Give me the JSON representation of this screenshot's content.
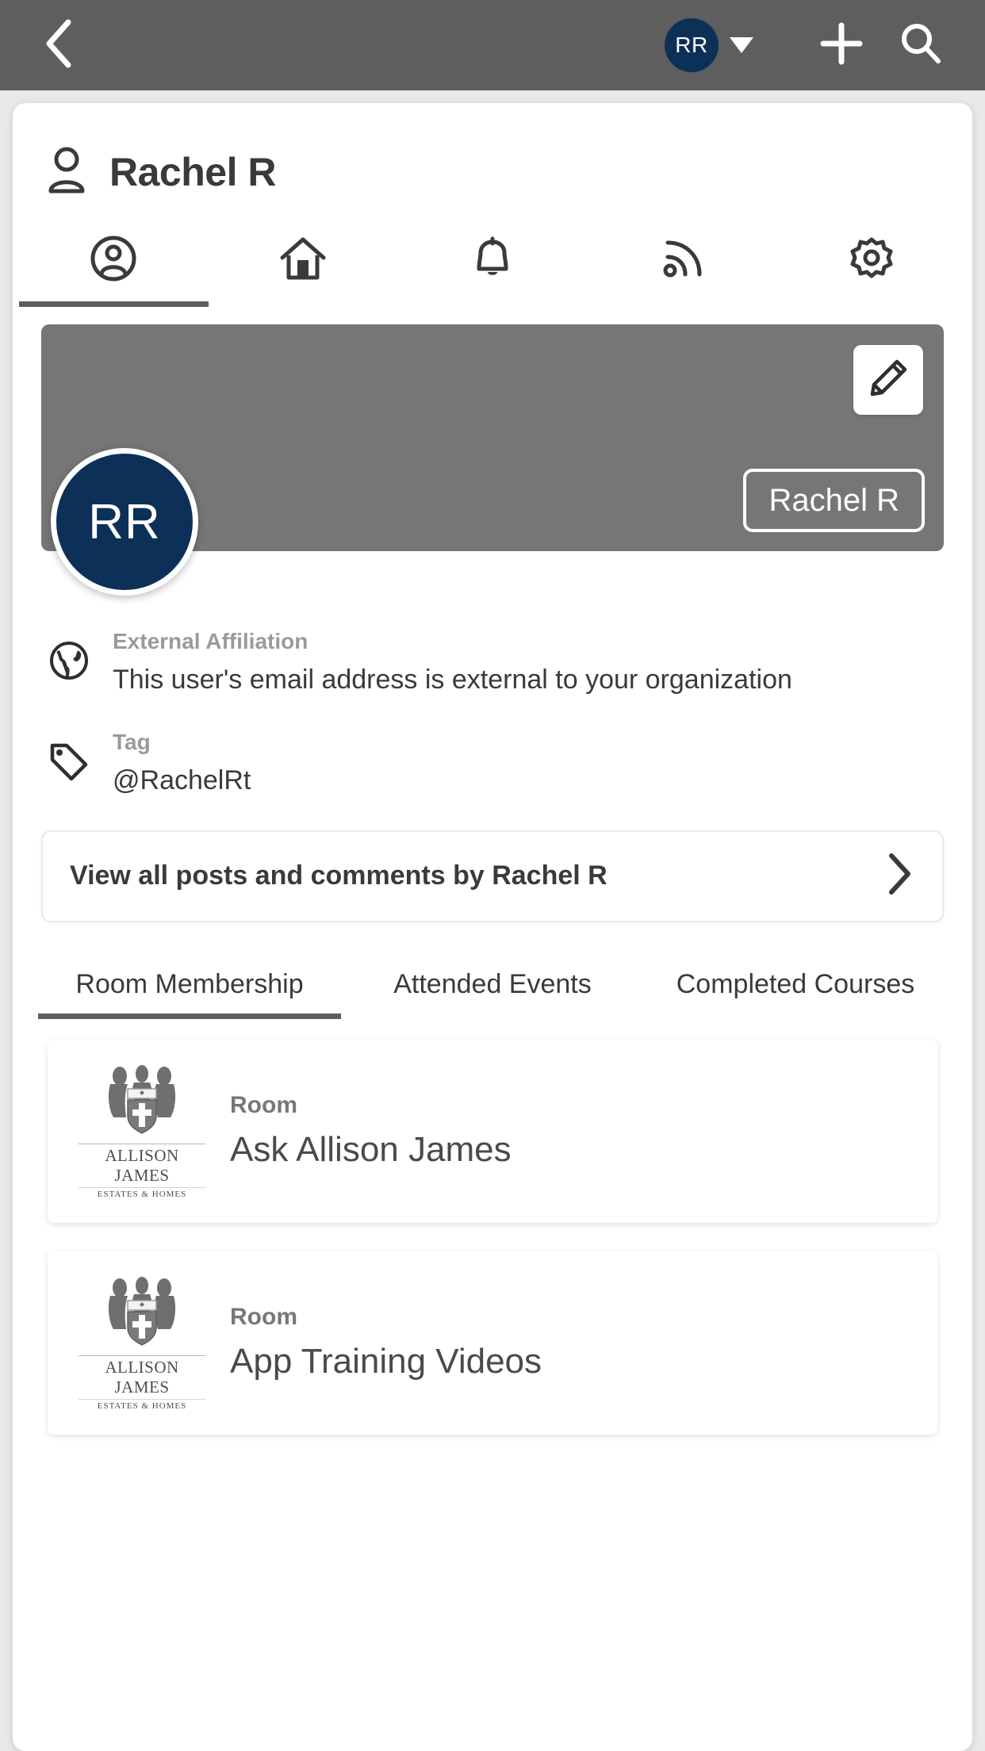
{
  "appbar": {
    "back_icon": "chevron-left-icon",
    "account_initials": "RR",
    "caret_icon": "chevron-down-icon",
    "add_icon": "plus-icon",
    "search_icon": "search-icon"
  },
  "profile": {
    "person_icon": "person-icon",
    "name": "Rachel R"
  },
  "icon_tabs": [
    {
      "name": "profile",
      "icon": "user-circle-icon",
      "active": true
    },
    {
      "name": "home",
      "icon": "home-icon",
      "active": false
    },
    {
      "name": "notifications",
      "icon": "bell-icon",
      "active": false
    },
    {
      "name": "feed",
      "icon": "rss-icon",
      "active": false
    },
    {
      "name": "settings",
      "icon": "gear-icon",
      "active": false
    }
  ],
  "banner": {
    "edit_icon": "pencil-icon",
    "display_name": "Rachel R",
    "avatar_initials": "RR",
    "background_color": "#767676",
    "avatar_color": "#0d3058"
  },
  "info": [
    {
      "icon": "globe-icon",
      "label": "External Affiliation",
      "value": "This user's email address is external to your organization"
    },
    {
      "icon": "tag-icon",
      "label": "Tag",
      "value": "@RachelRt"
    }
  ],
  "posts_link": {
    "label": "View all posts and comments by Rachel R",
    "chevron_icon": "chevron-right-icon"
  },
  "section_tabs": [
    {
      "label": "Room Membership",
      "active": true
    },
    {
      "label": "Attended Events",
      "active": false
    },
    {
      "label": "Completed Courses",
      "active": false
    }
  ],
  "rooms": [
    {
      "kicker": "Room",
      "name": "Ask Allison James",
      "logo_primary": "ALLISON JAMES",
      "logo_secondary": "ESTATES & HOMES",
      "logo_icon": "coat-of-arms-icon"
    },
    {
      "kicker": "Room",
      "name": "App Training Videos",
      "logo_primary": "ALLISON JAMES",
      "logo_secondary": "ESTATES & HOMES",
      "logo_icon": "coat-of-arms-icon"
    }
  ]
}
